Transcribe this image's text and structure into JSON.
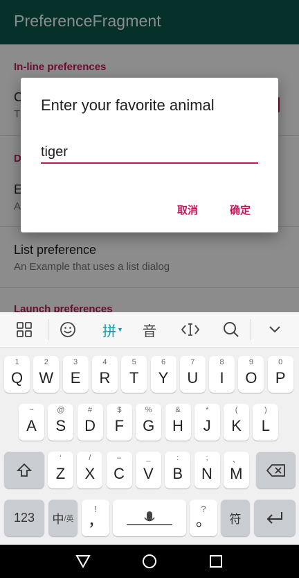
{
  "app_bar": {
    "title": "PreferenceFragment"
  },
  "content": {
    "category_inline": "In-line preferences",
    "item_checkbox": {
      "title_partial": "C",
      "summary_partial": "T"
    },
    "category_dialog_partial": "D",
    "item_edittext": {
      "title_partial": "E",
      "summary_partial": "A"
    },
    "item_list": {
      "title": "List preference",
      "summary": "An Example that uses a list dialog"
    },
    "category_launch": "Launch preferences"
  },
  "dialog": {
    "title": "Enter your favorite animal",
    "input_value": "tiger",
    "cancel_label": "取消",
    "ok_label": "确定"
  },
  "keyboard": {
    "toolbar": {
      "grid": "grid-icon",
      "emoji": "emoji-icon",
      "pinyin": "拼",
      "voice": "音",
      "cursor": "cursor-icon",
      "search": "search-icon",
      "hide": "chevron-down-icon"
    },
    "row1": [
      {
        "main": "Q",
        "sub": "1"
      },
      {
        "main": "W",
        "sub": "2"
      },
      {
        "main": "E",
        "sub": "3"
      },
      {
        "main": "R",
        "sub": "4"
      },
      {
        "main": "T",
        "sub": "5"
      },
      {
        "main": "Y",
        "sub": "6"
      },
      {
        "main": "U",
        "sub": "7"
      },
      {
        "main": "I",
        "sub": "8"
      },
      {
        "main": "O",
        "sub": "9"
      },
      {
        "main": "P",
        "sub": "0"
      }
    ],
    "row2": [
      {
        "main": "A",
        "sub": "~"
      },
      {
        "main": "S",
        "sub": "@"
      },
      {
        "main": "D",
        "sub": "#"
      },
      {
        "main": "F",
        "sub": "$"
      },
      {
        "main": "G",
        "sub": "%"
      },
      {
        "main": "H",
        "sub": "&"
      },
      {
        "main": "J",
        "sub": "*"
      },
      {
        "main": "K",
        "sub": "("
      },
      {
        "main": "L",
        "sub": ")"
      }
    ],
    "row3": [
      {
        "main": "Z",
        "sub": "‘"
      },
      {
        "main": "X",
        "sub": "/"
      },
      {
        "main": "C",
        "sub": "–"
      },
      {
        "main": "V",
        "sub": "_"
      },
      {
        "main": "B",
        "sub": ":"
      },
      {
        "main": "N",
        "sub": ";"
      },
      {
        "main": "M",
        "sub": "、"
      }
    ],
    "row4": {
      "num": "123",
      "lang_main": "中",
      "lang_sub": "/英",
      "comma_main": "，",
      "comma_sub": "!",
      "period_main": "。",
      "period_sub": "?",
      "symbol": "符"
    }
  },
  "nav": {
    "back": "back-icon",
    "home": "home-icon",
    "recents": "recents-icon"
  },
  "colors": {
    "appbar": "#0b5a4f",
    "accent": "#c2185b",
    "kbd_active": "#0a9aa6"
  }
}
